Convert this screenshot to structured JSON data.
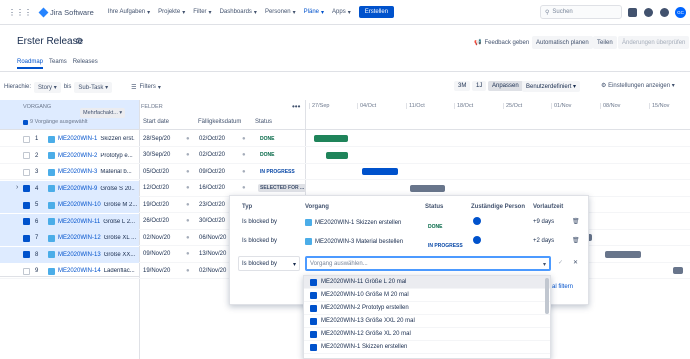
{
  "nav": {
    "logo": "Jira Software",
    "items": [
      "Ihre Aufgaben",
      "Projekte",
      "Filter",
      "Dashboards",
      "Personen",
      "Pläne",
      "Apps"
    ],
    "active_index": 5,
    "create": "Erstellen",
    "search_placeholder": "Suchen",
    "avatar": "GC"
  },
  "page": {
    "title": "Erster Release",
    "tabs": [
      "Roadmap",
      "Teams",
      "Releases"
    ],
    "active_tab": 0,
    "actions": {
      "feedback": "Feedback geben",
      "auto_plan": "Automatisch planen",
      "share": "Teilen",
      "review": "Änderungen überprüfen"
    }
  },
  "toolbar": {
    "hierarchy_label": "Hierachie:",
    "from": "Story",
    "bis": "bis",
    "to": "Sub-Task",
    "filters": "Filters",
    "time_options": [
      "3M",
      "1J"
    ],
    "custom": "Anpassen",
    "custom_sel": "Benutzerdefiniert",
    "view_settings": "Einstellungen anzeigen"
  },
  "grid": {
    "col_vorgang": "VORGANG",
    "selected": "9 Vorgänge ausgewählt",
    "multi": "Mehrfachakt...",
    "col_felder": "FELDER",
    "col_start": "Start date",
    "col_due": "Fälligkeitsdatum",
    "col_status": "Status",
    "dates": [
      "27/Sep",
      "04/Oct",
      "11/Oct",
      "18/Oct",
      "25/Oct",
      "01/Nov",
      "08/Nov",
      "15/Nov"
    ],
    "rows": [
      {
        "n": "1",
        "key": "ME2020WIN-1",
        "title": "Skizzen erst...",
        "start": "28/Sep/20",
        "due": "02/Oct/20",
        "status": "DONE",
        "sel": false
      },
      {
        "n": "2",
        "key": "ME2020WIN-2",
        "title": "Prototyp e...",
        "start": "30/Sep/20",
        "due": "02/Oct/20",
        "status": "DONE",
        "sel": false
      },
      {
        "n": "3",
        "key": "ME2020WIN-3",
        "title": "Material b...",
        "start": "05/Oct/20",
        "due": "09/Oct/20",
        "status": "IN PROGRESS",
        "sel": false
      },
      {
        "n": "4",
        "key": "ME2020WIN-9",
        "title": "Größe S 20...",
        "start": "12/Oct/20",
        "due": "16/Oct/20",
        "status": "SELECTED FOR ...",
        "sel": true
      },
      {
        "n": "5",
        "key": "ME2020WIN-10",
        "title": "Größe M 2...",
        "start": "19/Oct/20",
        "due": "23/Oct/20",
        "status": "",
        "sel": true
      },
      {
        "n": "6",
        "key": "ME2020WIN-11",
        "title": "Größe L 2...",
        "start": "26/Oct/20",
        "due": "30/Oct/20",
        "status": "",
        "sel": true
      },
      {
        "n": "7",
        "key": "ME2020WIN-12",
        "title": "Größe XL ...",
        "start": "02/Nov/20",
        "due": "06/Nov/20",
        "status": "",
        "sel": true
      },
      {
        "n": "8",
        "key": "ME2020WIN-13",
        "title": "Größe XX...",
        "start": "09/Nov/20",
        "due": "13/Nov/20",
        "status": "",
        "sel": true
      },
      {
        "n": "9",
        "key": "ME2020WIN-14",
        "title": "Ladenfläc...",
        "start": "19/Nov/20",
        "due": "02/Nov/20",
        "status": "",
        "sel": false
      }
    ]
  },
  "popup": {
    "h_type": "Typ",
    "h_issue": "Vorgang",
    "h_status": "Status",
    "h_assignee": "Zuständige Person",
    "h_run": "Vorlaufzeit",
    "rows": [
      {
        "type": "Is blocked by",
        "issue": "ME2020WIN-1 Skizzen erstellen",
        "status": "DONE",
        "run": "+9 days"
      },
      {
        "type": "Is blocked by",
        "issue": "ME2020WIN-3 Material bestellen",
        "status": "IN PROGRESS",
        "run": "+2 days"
      }
    ],
    "new_type": "Is blocked by",
    "new_placeholder": "Vorgang auswählen...",
    "link": "al filtern"
  },
  "dropdown": [
    "ME2020WIN-11 Größe L 20 mal",
    "ME2020WIN-10 Größe M 20 mal",
    "ME2020WIN-2 Prototyp erstellen",
    "ME2020WIN-13 Größe XXL 20 mal",
    "ME2020WIN-12 Größe XL 20 mal",
    "ME2020WIN-1 Skizzen erstellen"
  ]
}
